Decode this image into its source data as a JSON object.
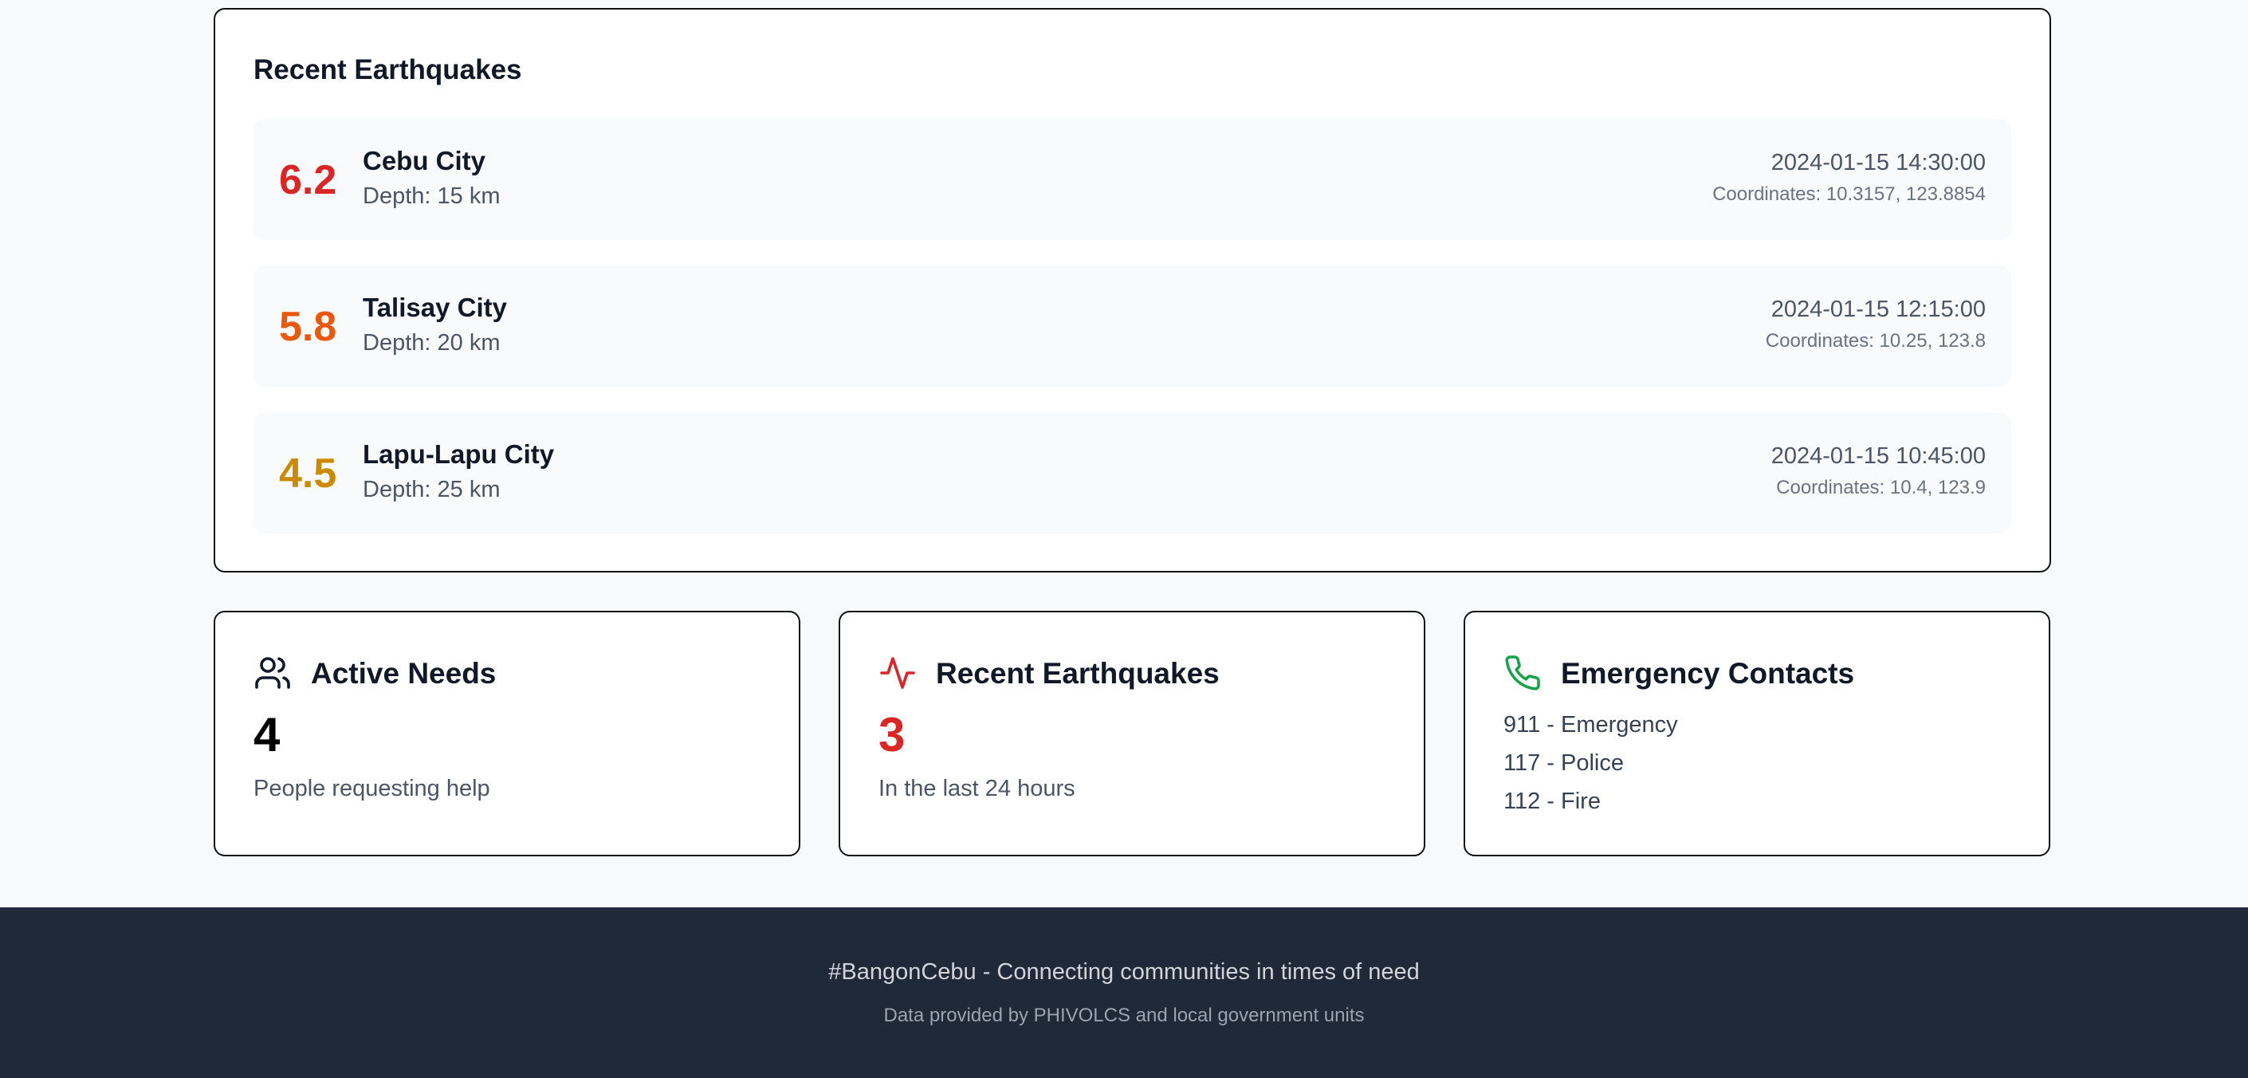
{
  "recent_panel": {
    "title": "Recent Earthquakes",
    "items": [
      {
        "magnitude": "6.2",
        "location": "Cebu City",
        "depth": "Depth: 15 km",
        "datetime": "2024-01-15 14:30:00",
        "coordinates": "Coordinates: 10.3157, 123.8854",
        "color": "#dc2626"
      },
      {
        "magnitude": "5.8",
        "location": "Talisay City",
        "depth": "Depth: 20 km",
        "datetime": "2024-01-15 12:15:00",
        "coordinates": "Coordinates: 10.25, 123.8",
        "color": "#ea580c"
      },
      {
        "magnitude": "4.5",
        "location": "Lapu-Lapu City",
        "depth": "Depth: 25 km",
        "datetime": "2024-01-15 10:45:00",
        "coordinates": "Coordinates: 10.4, 123.9",
        "color": "#ca8a04"
      }
    ]
  },
  "stats": {
    "active_needs": {
      "icon": "users-icon",
      "title": "Active Needs",
      "value": "4",
      "subtitle": "People requesting help",
      "value_color": "#000000"
    },
    "recent_quakes": {
      "icon": "activity-icon",
      "title": "Recent Earthquakes",
      "value": "3",
      "subtitle": "In the last 24 hours",
      "value_color": "#dc2626",
      "icon_color": "#dc2626"
    },
    "emergency": {
      "icon": "phone-icon",
      "title": "Emergency Contacts",
      "icon_color": "#16a34a",
      "contacts": [
        "911 - Emergency",
        "117 - Police",
        "112 - Fire"
      ]
    }
  },
  "footer": {
    "tagline": "#BangonCebu - Connecting communities in times of need",
    "credit": "Data provided by PHIVOLCS and local government units"
  }
}
